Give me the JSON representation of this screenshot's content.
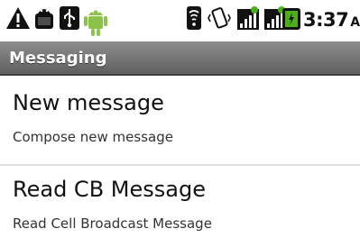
{
  "status_bar": {
    "icons": [
      "warning-icon",
      "android-lock-icon",
      "usb-icon",
      "android-debug-icon",
      "wifi-icon",
      "vibrate-icon",
      "signal-icon",
      "signal-icon-2",
      "battery-icon"
    ],
    "clock_time": "3:37",
    "clock_ampm": "AM"
  },
  "title_bar": {
    "title": "Messaging"
  },
  "menu": {
    "items": [
      {
        "title": "New message",
        "subtitle": "Compose new message"
      },
      {
        "title": "Read CB Message",
        "subtitle": "Read Cell Broadcast Message"
      }
    ]
  },
  "colors": {
    "title_bar_top": "#8e8e8e",
    "title_bar_bottom": "#5f5f5f",
    "signal_green": "#4caf1a",
    "android_green": "#8bc34a"
  }
}
